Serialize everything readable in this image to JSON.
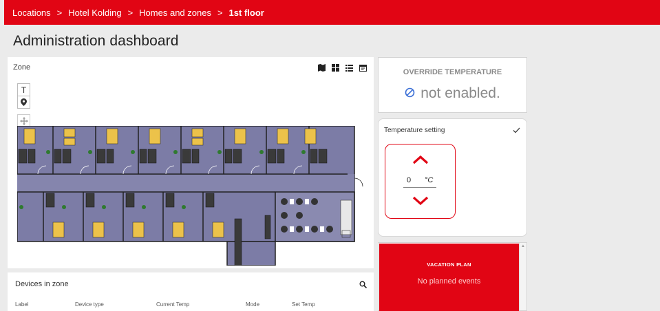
{
  "breadcrumb": {
    "items": [
      "Locations",
      "Hotel Kolding",
      "Homes and zones"
    ],
    "current": "1st floor",
    "separator": ">"
  },
  "page_title": "Administration dashboard",
  "zone_panel": {
    "title": "Zone",
    "tools": [
      "map-icon",
      "grid-view-icon",
      "list-view-icon",
      "calendar-icon"
    ],
    "map_buttons": [
      "text-tool-icon",
      "location-pin-icon",
      "move-icon"
    ],
    "map_text_glyph": "T"
  },
  "devices_panel": {
    "title": "Devices in zone",
    "columns": [
      "Label",
      "Device type",
      "Current Temp",
      "Mode",
      "Set Temp"
    ]
  },
  "override": {
    "title": "OVERRIDE TEMPERATURE",
    "status": "not enabled."
  },
  "temperature": {
    "title": "Temperature setting",
    "value": "0",
    "unit": "°C"
  },
  "vacation": {
    "title": "VACATION PLAN",
    "text": "No planned events"
  },
  "colors": {
    "accent": "#e10514",
    "floor": "#7c7ca6",
    "room_wall": "#333333"
  }
}
